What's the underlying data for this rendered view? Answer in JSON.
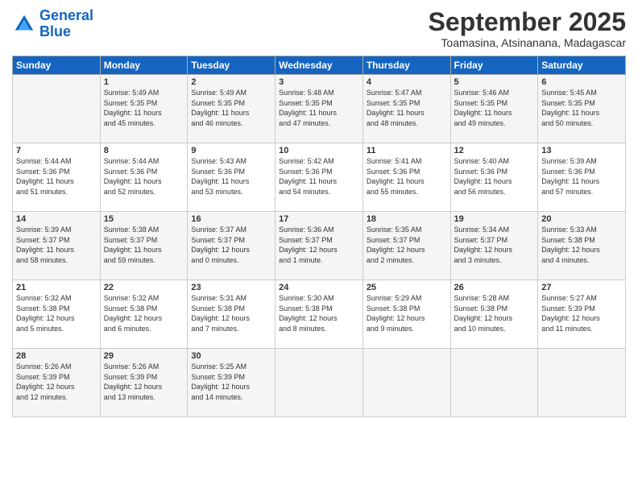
{
  "header": {
    "logo_line1": "General",
    "logo_line2": "Blue",
    "month": "September 2025",
    "location": "Toamasina, Atsinanana, Madagascar"
  },
  "days_of_week": [
    "Sunday",
    "Monday",
    "Tuesday",
    "Wednesday",
    "Thursday",
    "Friday",
    "Saturday"
  ],
  "weeks": [
    [
      {
        "day": "",
        "info": ""
      },
      {
        "day": "1",
        "info": "Sunrise: 5:49 AM\nSunset: 5:35 PM\nDaylight: 11 hours\nand 45 minutes."
      },
      {
        "day": "2",
        "info": "Sunrise: 5:49 AM\nSunset: 5:35 PM\nDaylight: 11 hours\nand 46 minutes."
      },
      {
        "day": "3",
        "info": "Sunrise: 5:48 AM\nSunset: 5:35 PM\nDaylight: 11 hours\nand 47 minutes."
      },
      {
        "day": "4",
        "info": "Sunrise: 5:47 AM\nSunset: 5:35 PM\nDaylight: 11 hours\nand 48 minutes."
      },
      {
        "day": "5",
        "info": "Sunrise: 5:46 AM\nSunset: 5:35 PM\nDaylight: 11 hours\nand 49 minutes."
      },
      {
        "day": "6",
        "info": "Sunrise: 5:45 AM\nSunset: 5:35 PM\nDaylight: 11 hours\nand 50 minutes."
      }
    ],
    [
      {
        "day": "7",
        "info": "Sunrise: 5:44 AM\nSunset: 5:36 PM\nDaylight: 11 hours\nand 51 minutes."
      },
      {
        "day": "8",
        "info": "Sunrise: 5:44 AM\nSunset: 5:36 PM\nDaylight: 11 hours\nand 52 minutes."
      },
      {
        "day": "9",
        "info": "Sunrise: 5:43 AM\nSunset: 5:36 PM\nDaylight: 11 hours\nand 53 minutes."
      },
      {
        "day": "10",
        "info": "Sunrise: 5:42 AM\nSunset: 5:36 PM\nDaylight: 11 hours\nand 54 minutes."
      },
      {
        "day": "11",
        "info": "Sunrise: 5:41 AM\nSunset: 5:36 PM\nDaylight: 11 hours\nand 55 minutes."
      },
      {
        "day": "12",
        "info": "Sunrise: 5:40 AM\nSunset: 5:36 PM\nDaylight: 11 hours\nand 56 minutes."
      },
      {
        "day": "13",
        "info": "Sunrise: 5:39 AM\nSunset: 5:36 PM\nDaylight: 11 hours\nand 57 minutes."
      }
    ],
    [
      {
        "day": "14",
        "info": "Sunrise: 5:39 AM\nSunset: 5:37 PM\nDaylight: 11 hours\nand 58 minutes."
      },
      {
        "day": "15",
        "info": "Sunrise: 5:38 AM\nSunset: 5:37 PM\nDaylight: 11 hours\nand 59 minutes."
      },
      {
        "day": "16",
        "info": "Sunrise: 5:37 AM\nSunset: 5:37 PM\nDaylight: 12 hours\nand 0 minutes."
      },
      {
        "day": "17",
        "info": "Sunrise: 5:36 AM\nSunset: 5:37 PM\nDaylight: 12 hours\nand 1 minute."
      },
      {
        "day": "18",
        "info": "Sunrise: 5:35 AM\nSunset: 5:37 PM\nDaylight: 12 hours\nand 2 minutes."
      },
      {
        "day": "19",
        "info": "Sunrise: 5:34 AM\nSunset: 5:37 PM\nDaylight: 12 hours\nand 3 minutes."
      },
      {
        "day": "20",
        "info": "Sunrise: 5:33 AM\nSunset: 5:38 PM\nDaylight: 12 hours\nand 4 minutes."
      }
    ],
    [
      {
        "day": "21",
        "info": "Sunrise: 5:32 AM\nSunset: 5:38 PM\nDaylight: 12 hours\nand 5 minutes."
      },
      {
        "day": "22",
        "info": "Sunrise: 5:32 AM\nSunset: 5:38 PM\nDaylight: 12 hours\nand 6 minutes."
      },
      {
        "day": "23",
        "info": "Sunrise: 5:31 AM\nSunset: 5:38 PM\nDaylight: 12 hours\nand 7 minutes."
      },
      {
        "day": "24",
        "info": "Sunrise: 5:30 AM\nSunset: 5:38 PM\nDaylight: 12 hours\nand 8 minutes."
      },
      {
        "day": "25",
        "info": "Sunrise: 5:29 AM\nSunset: 5:38 PM\nDaylight: 12 hours\nand 9 minutes."
      },
      {
        "day": "26",
        "info": "Sunrise: 5:28 AM\nSunset: 5:38 PM\nDaylight: 12 hours\nand 10 minutes."
      },
      {
        "day": "27",
        "info": "Sunrise: 5:27 AM\nSunset: 5:39 PM\nDaylight: 12 hours\nand 11 minutes."
      }
    ],
    [
      {
        "day": "28",
        "info": "Sunrise: 5:26 AM\nSunset: 5:39 PM\nDaylight: 12 hours\nand 12 minutes."
      },
      {
        "day": "29",
        "info": "Sunrise: 5:26 AM\nSunset: 5:39 PM\nDaylight: 12 hours\nand 13 minutes."
      },
      {
        "day": "30",
        "info": "Sunrise: 5:25 AM\nSunset: 5:39 PM\nDaylight: 12 hours\nand 14 minutes."
      },
      {
        "day": "",
        "info": ""
      },
      {
        "day": "",
        "info": ""
      },
      {
        "day": "",
        "info": ""
      },
      {
        "day": "",
        "info": ""
      }
    ]
  ]
}
